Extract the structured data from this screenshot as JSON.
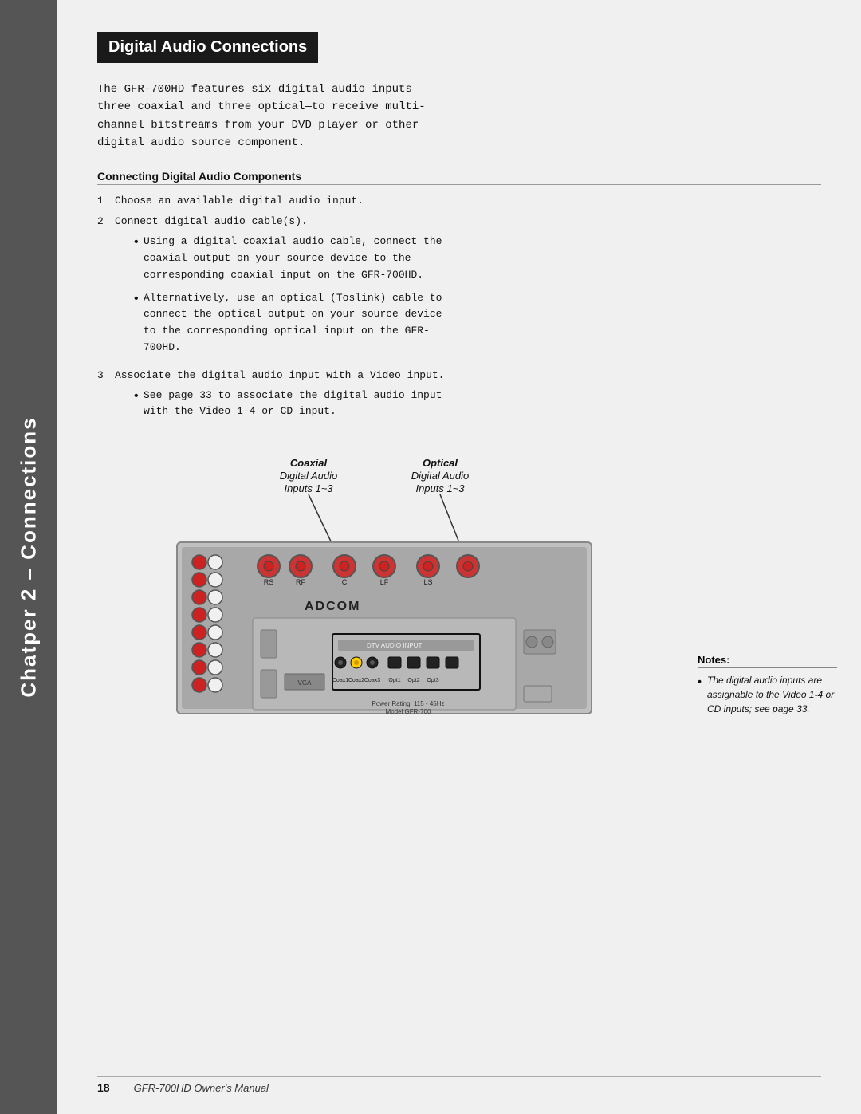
{
  "sidebar": {
    "text": "Chatper 2 – Connections",
    "bg_color": "#555555"
  },
  "title": {
    "banner_text": "Digital Audio Connections",
    "banner_bg": "#1a1a1a"
  },
  "intro": {
    "text": "The GFR-700HD features six digital audio inputs—three coaxial and three optical—to receive multi-channel bitstreams from your DVD player or other digital audio source component."
  },
  "section": {
    "header": "Connecting Digital Audio Components",
    "steps": [
      {
        "num": "1",
        "text": "Choose an available digital audio input."
      },
      {
        "num": "2",
        "text": "Connect digital audio cable(s).",
        "bullets": [
          "Using a digital coaxial audio cable, connect the  coaxial output on your source device to the corresponding coaxial input on the GFR-700HD.",
          "Alternatively, use an optical (Toslink) cable to connect the optical output on your source device to the corresponding optical input on the GFR-700HD."
        ]
      },
      {
        "num": "3",
        "text": "Associate the digital audio input with a Video input.",
        "bullets": [
          "See page 33 to associate the digital audio input with the Video 1-4 or CD input."
        ]
      }
    ]
  },
  "diagram": {
    "coaxial_label_line1": "Coaxial",
    "coaxial_label_line2": "Digital Audio",
    "coaxial_label_line3": "Inputs 1~3",
    "optical_label_line1": "Optical",
    "optical_label_line2": "Digital Audio",
    "optical_label_line3": "Inputs 1~3"
  },
  "notes": {
    "header": "Notes:",
    "bullet": "The digital audio inputs are assignable to the Video 1-4 or CD inputs; see page 33."
  },
  "footer": {
    "page_num": "18",
    "title": "GFR-700HD Owner's Manual"
  }
}
